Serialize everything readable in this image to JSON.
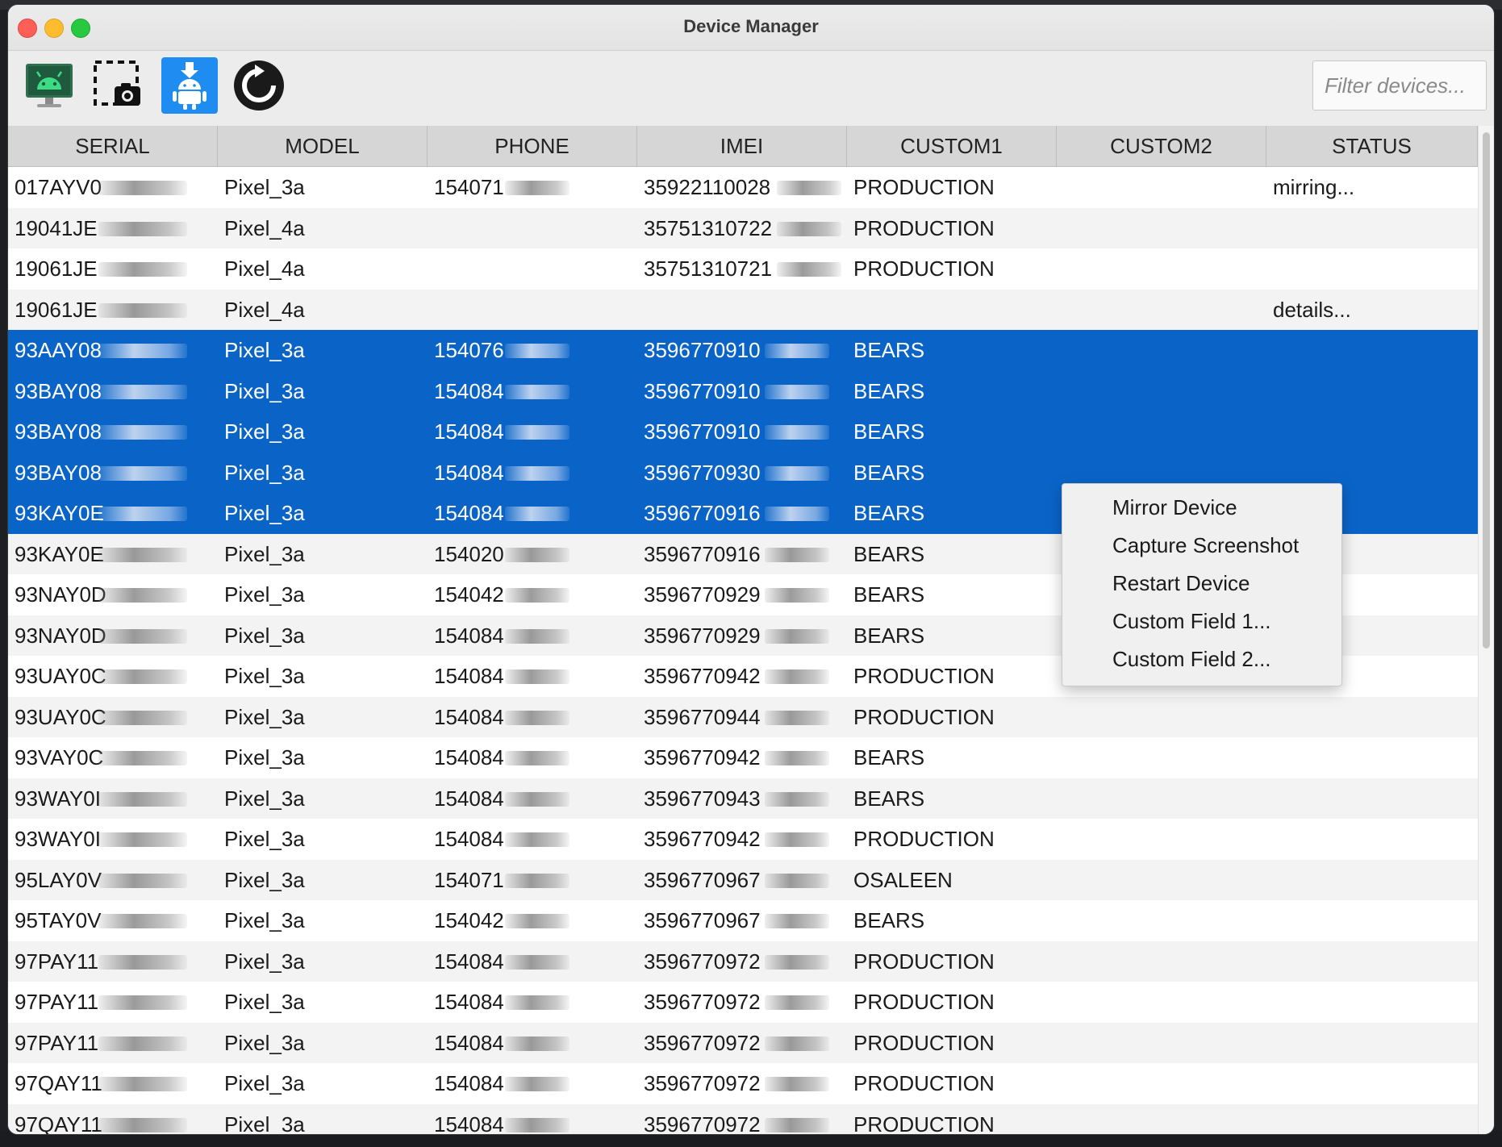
{
  "window": {
    "title": "Device Manager"
  },
  "toolbar": {
    "buttons": [
      {
        "icon": "android-monitor-icon",
        "action": "Mirror Device"
      },
      {
        "icon": "screenshot-capture-icon",
        "action": "Capture Screenshot"
      },
      {
        "icon": "android-install-icon",
        "action": "Install",
        "active": true
      },
      {
        "icon": "restart-icon",
        "action": "Restart Device"
      }
    ],
    "filter_placeholder": "Filter devices..."
  },
  "table": {
    "columns": [
      "SERIAL",
      "MODEL",
      "PHONE",
      "IMEI",
      "CUSTOM1",
      "CUSTOM2",
      "STATUS"
    ],
    "rows": [
      {
        "serial": "017AYV0",
        "model": "Pixel_3a",
        "phone": "154071",
        "imei": "35922110028",
        "custom1": "PRODUCTION",
        "custom2": "",
        "status": "mirring...",
        "selected": false
      },
      {
        "serial": "19041JE",
        "model": "Pixel_4a",
        "phone": "",
        "imei": "35751310722",
        "custom1": "PRODUCTION",
        "custom2": "",
        "status": "",
        "selected": false
      },
      {
        "serial": "19061JE",
        "model": "Pixel_4a",
        "phone": "",
        "imei": "35751310721",
        "custom1": "PRODUCTION",
        "custom2": "",
        "status": "",
        "selected": false
      },
      {
        "serial": "19061JE",
        "model": "Pixel_4a",
        "phone": "",
        "imei": "",
        "custom1": "",
        "custom2": "",
        "status": "details...",
        "selected": false
      },
      {
        "serial": "93AAY08",
        "model": "Pixel_3a",
        "phone": "154076",
        "imei": "3596770910",
        "custom1": "BEARS",
        "custom2": "",
        "status": "",
        "selected": true
      },
      {
        "serial": "93BAY08",
        "model": "Pixel_3a",
        "phone": "154084",
        "imei": "3596770910",
        "custom1": "BEARS",
        "custom2": "",
        "status": "",
        "selected": true
      },
      {
        "serial": "93BAY08",
        "model": "Pixel_3a",
        "phone": "154084",
        "imei": "3596770910",
        "custom1": "BEARS",
        "custom2": "",
        "status": "",
        "selected": true
      },
      {
        "serial": "93BAY08",
        "model": "Pixel_3a",
        "phone": "154084",
        "imei": "3596770930",
        "custom1": "BEARS",
        "custom2": "",
        "status": "",
        "selected": true
      },
      {
        "serial": "93KAY0E",
        "model": "Pixel_3a",
        "phone": "154084",
        "imei": "3596770916",
        "custom1": "BEARS",
        "custom2": "",
        "status": "",
        "selected": true
      },
      {
        "serial": "93KAY0E",
        "model": "Pixel_3a",
        "phone": "154020",
        "imei": "3596770916",
        "custom1": "BEARS",
        "custom2": "",
        "status": "",
        "selected": false
      },
      {
        "serial": "93NAY0D",
        "model": "Pixel_3a",
        "phone": "154042",
        "imei": "3596770929",
        "custom1": "BEARS",
        "custom2": "",
        "status": "",
        "selected": false
      },
      {
        "serial": "93NAY0D",
        "model": "Pixel_3a",
        "phone": "154084",
        "imei": "3596770929",
        "custom1": "BEARS",
        "custom2": "",
        "status": "",
        "selected": false
      },
      {
        "serial": "93UAY0C",
        "model": "Pixel_3a",
        "phone": "154084",
        "imei": "3596770942",
        "custom1": "PRODUCTION",
        "custom2": "",
        "status": "",
        "selected": false
      },
      {
        "serial": "93UAY0C",
        "model": "Pixel_3a",
        "phone": "154084",
        "imei": "3596770944",
        "custom1": "PRODUCTION",
        "custom2": "",
        "status": "",
        "selected": false
      },
      {
        "serial": "93VAY0C",
        "model": "Pixel_3a",
        "phone": "154084",
        "imei": "3596770942",
        "custom1": "BEARS",
        "custom2": "",
        "status": "",
        "selected": false
      },
      {
        "serial": "93WAY0I",
        "model": "Pixel_3a",
        "phone": "154084",
        "imei": "3596770943",
        "custom1": "BEARS",
        "custom2": "",
        "status": "",
        "selected": false
      },
      {
        "serial": "93WAY0I",
        "model": "Pixel_3a",
        "phone": "154084",
        "imei": "3596770942",
        "custom1": "PRODUCTION",
        "custom2": "",
        "status": "",
        "selected": false
      },
      {
        "serial": "95LAY0V",
        "model": "Pixel_3a",
        "phone": "154071",
        "imei": "3596770967",
        "custom1": "OSALEEN",
        "custom2": "",
        "status": "",
        "selected": false
      },
      {
        "serial": "95TAY0V",
        "model": "Pixel_3a",
        "phone": "154042",
        "imei": "3596770967",
        "custom1": "BEARS",
        "custom2": "",
        "status": "",
        "selected": false
      },
      {
        "serial": "97PAY11",
        "model": "Pixel_3a",
        "phone": "154084",
        "imei": "3596770972",
        "custom1": "PRODUCTION",
        "custom2": "",
        "status": "",
        "selected": false
      },
      {
        "serial": "97PAY11",
        "model": "Pixel_3a",
        "phone": "154084",
        "imei": "3596770972",
        "custom1": "PRODUCTION",
        "custom2": "",
        "status": "",
        "selected": false
      },
      {
        "serial": "97PAY11",
        "model": "Pixel_3a",
        "phone": "154084",
        "imei": "3596770972",
        "custom1": "PRODUCTION",
        "custom2": "",
        "status": "",
        "selected": false
      },
      {
        "serial": "97QAY11",
        "model": "Pixel_3a",
        "phone": "154084",
        "imei": "3596770972",
        "custom1": "PRODUCTION",
        "custom2": "",
        "status": "",
        "selected": false
      },
      {
        "serial": "97QAY11",
        "model": "Pixel_3a",
        "phone": "154084",
        "imei": "3596770972",
        "custom1": "PRODUCTION",
        "custom2": "",
        "status": "",
        "selected": false
      }
    ]
  },
  "context_menu": {
    "items": [
      "Mirror Device",
      "Capture Screenshot",
      "Restart Device",
      "Custom Field 1...",
      "Custom Field 2..."
    ]
  },
  "colors": {
    "selection": "#0a64c8",
    "install_button": "#1e8cf0",
    "android_green": "#3ddc84"
  }
}
